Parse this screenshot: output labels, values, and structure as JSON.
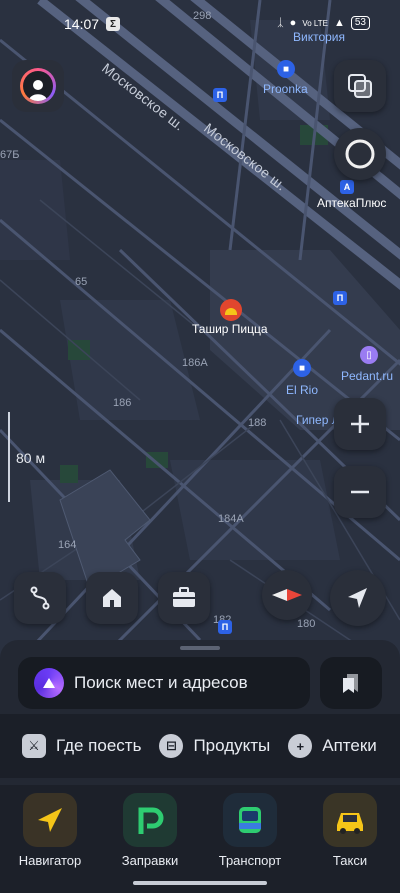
{
  "status_bar": {
    "time": "14:07",
    "app_badge": "Σ",
    "signal_text": "Vo LTE",
    "battery": "53"
  },
  "map": {
    "street_labels": [
      "Московское ш.",
      "Московское ш."
    ],
    "building_numbers": [
      "298",
      "67Б",
      "65",
      "186А",
      "186",
      "188",
      "184А",
      "164",
      "182",
      "180"
    ],
    "pois": {
      "viktoria": "Виктория",
      "proonka": "Рroоnka",
      "apteka": "АптекаПлюс",
      "tashir": "Ташир Пицца",
      "elrio": "El Rio",
      "pedant": "Pedant.ru",
      "giper": "Гипер Л"
    },
    "scale_label": "80 м"
  },
  "search": {
    "placeholder": "Поиск мест и адресов"
  },
  "categories": [
    {
      "label": "Где поесть",
      "icon": "fork-knife-icon"
    },
    {
      "label": "Продукты",
      "icon": "basket-icon"
    },
    {
      "label": "Аптеки",
      "icon": "plus-icon"
    }
  ],
  "dock": [
    {
      "label": "Навигатор",
      "icon": "navigator-arrow-icon",
      "color": "#3a3326"
    },
    {
      "label": "Заправки",
      "icon": "fuel-p-icon",
      "color": "#1f3a33"
    },
    {
      "label": "Транспорт",
      "icon": "bus-icon",
      "color": "#1f2c3a"
    },
    {
      "label": "Такси",
      "icon": "taxi-car-icon",
      "color": "#3a3526"
    }
  ],
  "colors": {
    "map_bg": "#2a3140",
    "road": "#4a5570",
    "accent_yellow": "#f5c518",
    "accent_green": "#2ecc71",
    "compass_red": "#e8463a"
  }
}
